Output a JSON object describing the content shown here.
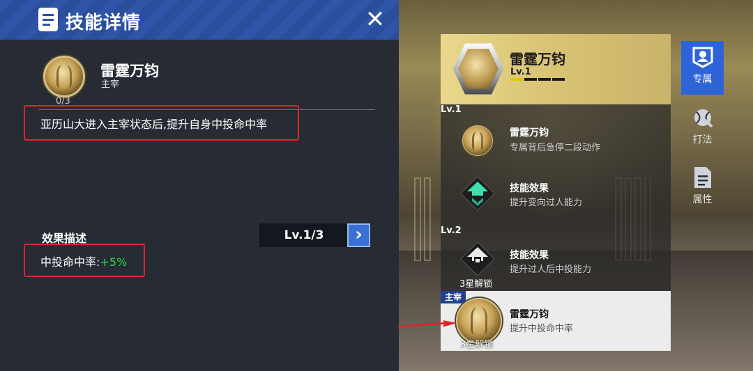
{
  "header": {
    "title": "技能详情",
    "close_icon": "close-icon"
  },
  "skill": {
    "name": "雷霆万钧",
    "role": "主宰",
    "count": "0/3",
    "description": "亚历山大进入主宰状态后,提升自身中投命中率"
  },
  "effect": {
    "title": "效果描述",
    "level_display": "Lv.1/3",
    "stat_label": "中投命中率:",
    "stat_value": "+5%",
    "value_color": "#2bd84a"
  },
  "list": {
    "header_name": "雷霆万钧",
    "header_level": "Lv.1",
    "lv1_label": "Lv.1",
    "lv2_label": "Lv.2",
    "items": [
      {
        "name": "雷霆万钧",
        "desc": "专属背后急停二段动作"
      },
      {
        "name": "技能效果",
        "desc": "提升变向过人能力"
      },
      {
        "name": "技能效果",
        "desc": "提升过人后中投能力",
        "lock": "3星解锁"
      },
      {
        "name": "雷霆万钧",
        "desc": "提升中投命中率",
        "tag": "主宰",
        "lock": "3星解锁"
      }
    ]
  },
  "tabs": [
    {
      "label": "专属",
      "icon": "exclusive-icon",
      "active": true
    },
    {
      "label": "打法",
      "icon": "playstyle-icon",
      "active": false
    },
    {
      "label": "属性",
      "icon": "attributes-icon",
      "active": false
    }
  ],
  "colors": {
    "accent": "#2f64d9",
    "highlight": "#e0242a",
    "gold": "#d8c274"
  }
}
